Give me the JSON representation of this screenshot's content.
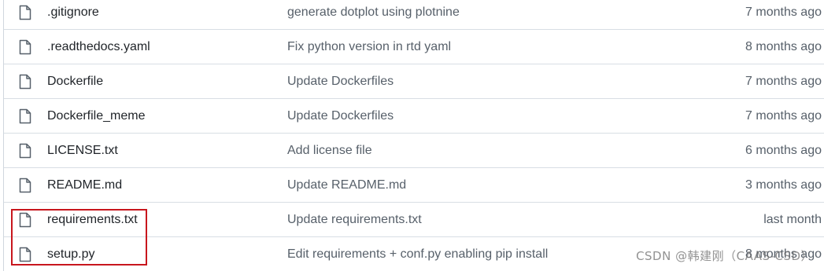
{
  "files": [
    {
      "name": ".gitignore",
      "message": "generate dotplot using plotnine",
      "age": "7 months ago",
      "icon": "file-icon"
    },
    {
      "name": ".readthedocs.yaml",
      "message": "Fix python version in rtd yaml",
      "age": "8 months ago",
      "icon": "file-icon"
    },
    {
      "name": "Dockerfile",
      "message": "Update Dockerfiles",
      "age": "7 months ago",
      "icon": "file-icon"
    },
    {
      "name": "Dockerfile_meme",
      "message": "Update Dockerfiles",
      "age": "7 months ago",
      "icon": "file-icon"
    },
    {
      "name": "LICENSE.txt",
      "message": "Add license file",
      "age": "6 months ago",
      "icon": "file-icon"
    },
    {
      "name": "README.md",
      "message": "Update README.md",
      "age": "3 months ago",
      "icon": "file-icon"
    },
    {
      "name": "requirements.txt",
      "message": "Update requirements.txt",
      "age": "last month",
      "icon": "file-icon"
    },
    {
      "name": "setup.py",
      "message": "Edit requirements + conf.py enabling pip install",
      "age": "8 months ago",
      "icon": "file-icon"
    }
  ],
  "watermark": "CSDN @韩建刚（CAAS-CSD）",
  "colors": {
    "highlight": "#c8161d",
    "text": "#1f2328",
    "muted": "#57606a",
    "border": "#d8dee4"
  }
}
